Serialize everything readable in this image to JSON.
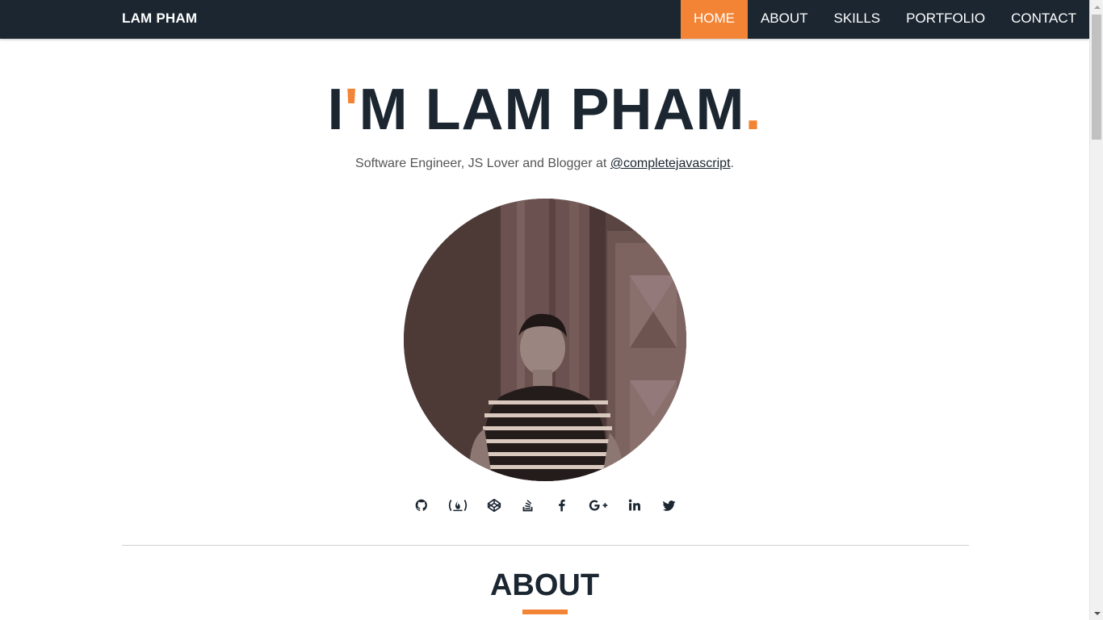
{
  "brand": "LAM PHAM",
  "nav": [
    {
      "label": "HOME",
      "active": true
    },
    {
      "label": "ABOUT",
      "active": false
    },
    {
      "label": "SKILLS",
      "active": false
    },
    {
      "label": "PORTFOLIO",
      "active": false
    },
    {
      "label": "CONTACT",
      "active": false
    }
  ],
  "hero": {
    "title_part1": "I",
    "title_apostrophe": "'",
    "title_part2": "M LAM PHAM",
    "title_period": ".",
    "subtitle_prefix": "Software Engineer, JS Lover and Blogger at ",
    "subtitle_link": "@completejavascript",
    "subtitle_suffix": "."
  },
  "socials": [
    "github-icon",
    "freecodecamp-icon",
    "codepen-icon",
    "stackoverflow-icon",
    "facebook-icon",
    "google-plus-icon",
    "linkedin-icon",
    "twitter-icon"
  ],
  "section": {
    "title": "ABOUT"
  },
  "colors": {
    "navbar": "#1b2631",
    "accent": "#f48435",
    "text": "#1b2631"
  }
}
